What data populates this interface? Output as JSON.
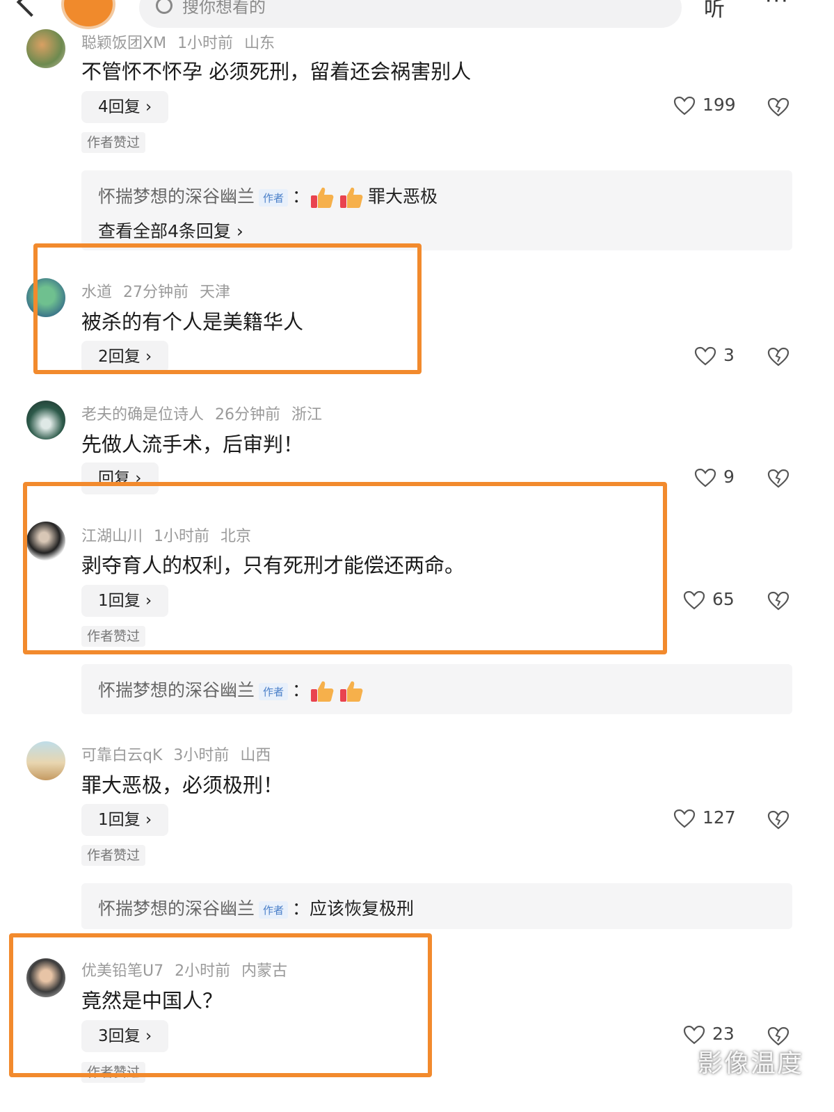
{
  "header": {
    "search_placeholder": "搜你想看的",
    "listen_label": "听",
    "more_label": "···"
  },
  "comments": [
    {
      "user": "聪颖饭团XM",
      "time": "1小时前",
      "location": "山东",
      "text": "不管怀不怀孕 必须死刑，留着还会祸害别人",
      "replies_label": "4回复 ›",
      "likes": "199",
      "author_liked": "作者赞过",
      "author_reply": {
        "name": "怀揣梦想的深谷幽兰",
        "tag": "作者",
        "text": "罪大恶极",
        "view_all": "查看全部4条回复 ›"
      }
    },
    {
      "user": "水道",
      "time": "27分钟前",
      "location": "天津",
      "text": "被杀的有个人是美籍华人",
      "replies_label": "2回复 ›",
      "likes": "3"
    },
    {
      "user": "老夫的确是位诗人",
      "time": "26分钟前",
      "location": "浙江",
      "text": "先做人流手术，后审判！",
      "replies_label": "回复 ›",
      "likes": "9"
    },
    {
      "user": "江湖山川",
      "time": "1小时前",
      "location": "北京",
      "text": "剥夺育人的权利，只有死刑才能偿还两命。",
      "replies_label": "1回复 ›",
      "likes": "65",
      "author_liked": "作者赞过",
      "author_reply": {
        "name": "怀揣梦想的深谷幽兰",
        "tag": "作者",
        "text": ""
      }
    },
    {
      "user": "可靠白云qK",
      "time": "3小时前",
      "location": "山西",
      "text": "罪大恶极，必须极刑！",
      "replies_label": "1回复 ›",
      "likes": "127",
      "author_liked": "作者赞过",
      "author_reply": {
        "name": "怀揣梦想的深谷幽兰",
        "tag": "作者",
        "text": "应该恢复极刑"
      }
    },
    {
      "user": "优美铅笔U7",
      "time": "2小时前",
      "location": "内蒙古",
      "text": "竟然是中国人？",
      "replies_label": "3回复 ›",
      "likes": "23",
      "author_liked": "作者赞过"
    }
  ],
  "watermark": "影像温度",
  "colors": {
    "highlight": "#f28a2d",
    "author_tag": "#4a7fc8"
  }
}
